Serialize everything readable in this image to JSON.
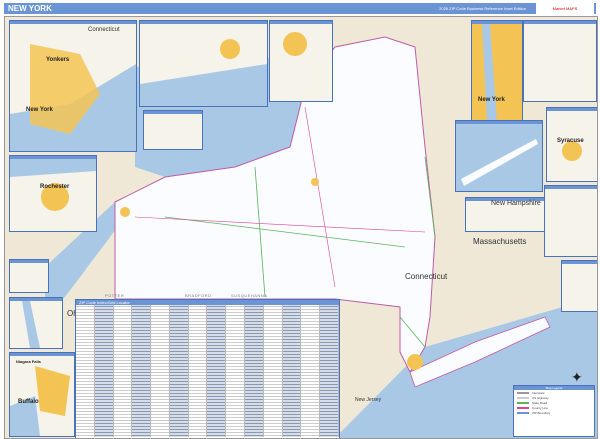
{
  "header": {
    "title": "NEW YORK",
    "subtitle": "2026 ZIP Code Business Reference Inset Edition",
    "logo": "Market MAPS"
  },
  "labels": {
    "connecticut_top": "Connecticut",
    "connecticut": "Connecticut",
    "massachusetts": "Massachusetts",
    "new_hampshire": "New Hampshire",
    "ohio": "Ohio",
    "new_jersey": "New Jersey"
  },
  "cities": {
    "yonkers": "Yonkers",
    "new_york": "New York",
    "new_york_inset": "New York",
    "rochester": "Rochester",
    "syracuse": "Syracuse",
    "buffalo": "Buffalo",
    "niagara_falls": "Niagara Falls"
  },
  "counties": [
    "POTTER",
    "BRADFORD",
    "SUSQUEHANNA"
  ],
  "legend": {
    "title": "ZIP Code Index/Grid Locator"
  },
  "key": {
    "title": "Map Legend",
    "items": [
      "Interstate",
      "US Highway",
      "State Road",
      "County Line",
      "ZIP Boundary"
    ]
  },
  "colors": {
    "water": "#a9c8e6",
    "urban": "#f3c453",
    "state": "#ffffff",
    "neighbor": "#efe8d6",
    "header": "#6a94d4"
  }
}
